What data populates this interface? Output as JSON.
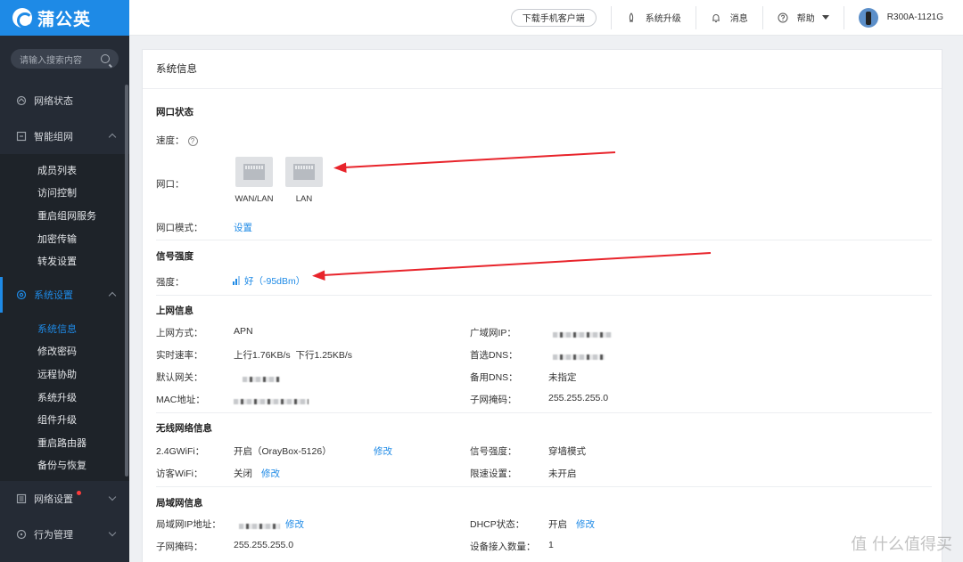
{
  "brand": {
    "name": "蒲公英"
  },
  "sidebar": {
    "search_placeholder": "请输入搜索内容",
    "groups": [
      {
        "label": "网络状态"
      },
      {
        "label": "智能组网",
        "items": [
          "成员列表",
          "访问控制",
          "重启组网服务",
          "加密传输",
          "转发设置"
        ]
      },
      {
        "label": "系统设置",
        "items": [
          "系统信息",
          "修改密码",
          "远程协助",
          "系统升级",
          "组件升级",
          "重启路由器",
          "备份与恢复"
        ]
      },
      {
        "label": "网络设置"
      },
      {
        "label": "行为管理"
      }
    ]
  },
  "header": {
    "download_btn": "下载手机客户端",
    "upgrade": "系统升级",
    "messages": "消息",
    "help": "帮助",
    "device": "R300A-1121G"
  },
  "panel": {
    "title": "系统信息",
    "port_status": {
      "title": "网口状态",
      "speed_label": "速度：",
      "port_label": "网口：",
      "ports": [
        "WAN/LAN",
        "LAN"
      ],
      "mode_label": "网口模式：",
      "mode_link": "设置"
    },
    "signal": {
      "title": "信号强度",
      "strength_label": "强度：",
      "strength_value": "好（-95dBm）"
    },
    "internet": {
      "title": "上网信息",
      "access_label": "上网方式：",
      "access_value": "APN",
      "rate_label": "实时速率：",
      "rate_value": "上行1.76KB/s  下行1.25KB/s",
      "gateway_label": "默认网关：",
      "mac_label": "MAC地址：",
      "wan_ip_label": "广域网IP：",
      "dns1_label": "首选DNS：",
      "dns2_label": "备用DNS：",
      "dns2_value": "未指定",
      "mask_label": "子网掩码：",
      "mask_value": "255.255.255.0"
    },
    "wireless": {
      "title": "无线网络信息",
      "wifi24_label": "2.4GWiFi：",
      "wifi24_value": "开启（OrayBox-5126）",
      "wifi24_edit": "修改",
      "guest_label": "访客WiFi：",
      "guest_value": "关闭",
      "guest_edit": "修改",
      "signal_label": "信号强度：",
      "signal_value": "穿墙模式",
      "limit_label": "限速设置：",
      "limit_value": "未开启"
    },
    "lan": {
      "title": "局域网信息",
      "lan_ip_label": "局域网IP地址：",
      "lan_ip_edit": "修改",
      "mask_label": "子网掩码：",
      "mask_value": "255.255.255.0",
      "dhcp_label": "DHCP状态：",
      "dhcp_value": "开启",
      "dhcp_edit": "修改",
      "devices_label": "设备接入数量：",
      "devices_value": "1"
    }
  },
  "watermark": "值 什么值得买",
  "colors": {
    "accent": "#1e8ae6",
    "sidebar_bg": "#252b35",
    "arrow": "#e8242b"
  }
}
